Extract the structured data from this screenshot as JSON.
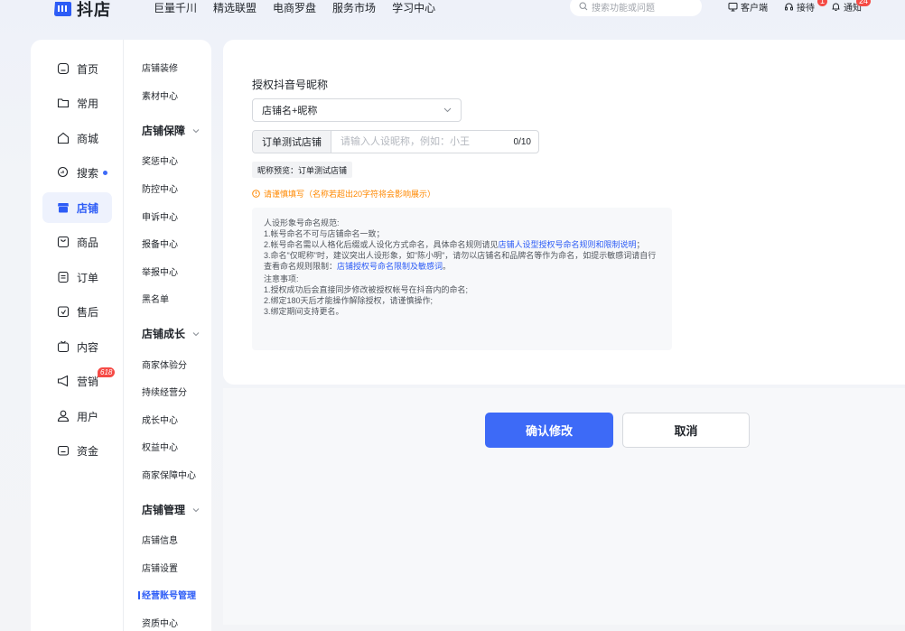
{
  "brand": {
    "name": "抖店",
    "color": "#2d5cf6"
  },
  "topnav": [
    "巨量千川",
    "精选联盟",
    "电商罗盘",
    "服务市场",
    "学习中心"
  ],
  "search": {
    "placeholder": "搜索功能或问题"
  },
  "topright": [
    {
      "icon": "monitor-icon",
      "label": "客户端",
      "badge": ""
    },
    {
      "icon": "headset-icon",
      "label": "接待",
      "badge": "1"
    },
    {
      "icon": "bell-icon",
      "label": "通知",
      "badge": "24"
    }
  ],
  "sidebar": {
    "items": [
      {
        "icon": "home-icon",
        "label": "首页"
      },
      {
        "icon": "folder-icon",
        "label": "常用"
      },
      {
        "icon": "mall-icon",
        "label": "商城"
      },
      {
        "icon": "search-icon",
        "label": "搜索"
      },
      {
        "icon": "store-icon",
        "label": "店铺"
      },
      {
        "icon": "product-icon",
        "label": "商品"
      },
      {
        "icon": "order-icon",
        "label": "订单"
      },
      {
        "icon": "aftersale-icon",
        "label": "售后"
      },
      {
        "icon": "content-icon",
        "label": "内容"
      },
      {
        "icon": "megaphone-icon",
        "label": "营销",
        "tag": "618"
      },
      {
        "icon": "user-icon",
        "label": "用户"
      },
      {
        "icon": "wallet-icon",
        "label": "资金"
      }
    ],
    "active_index": 4
  },
  "subnav": {
    "top": [
      "店铺装修",
      "素材中心"
    ],
    "groups": [
      {
        "title": "店铺保障",
        "items": [
          "奖惩中心",
          "防控中心",
          "申诉中心",
          "报备中心",
          "举报中心",
          "黑名单"
        ]
      },
      {
        "title": "店铺成长",
        "items": [
          "商家体验分",
          "持续经营分",
          "成长中心",
          "权益中心",
          "商家保障中心"
        ]
      },
      {
        "title": "店铺管理",
        "items": [
          "店铺信息",
          "店铺设置",
          "经营账号管理",
          "资质中心"
        ]
      }
    ],
    "active": "经营账号管理"
  },
  "form": {
    "label": "授权抖音号昵称",
    "select_value": "店铺名+昵称",
    "prefix": "订单测试店铺",
    "input_value": "",
    "input_placeholder": "请输入人设昵称，例如：小王",
    "counter": "0/10",
    "preview": "昵称预览：订单测试店铺",
    "warning": "请谨慎填写（名称若超出20字符将会影响展示）"
  },
  "rules": {
    "title": "人设形象号命名规范:",
    "r1": "1.帐号命名不可与店铺命名一致；",
    "r2_pre": "2.帐号命名需以人格化后缀或人设化方式命名，具体命名规则请见",
    "r2_link": "店铺人设型授权号命名规则和限制说明",
    "r2_post": "；",
    "r3_pre": "3.命名\"仅昵称\"时，建议突出人设形象，如\"陈小明\"，请勿以店铺名和品牌名等作为命名，如提示敏感词请自行查看命名规则限制：",
    "r3_link": "店铺授权号命名限制及敏感词",
    "r3_post": "。",
    "notes_title": "注意事项:",
    "n1": "1.授权成功后会直接同步修改被授权帐号在抖音内的命名;",
    "n2": "2.绑定180天后才能操作解除授权，请谨慎操作;",
    "n3": "3.绑定期间支持更名。"
  },
  "buttons": {
    "confirm": "确认修改",
    "cancel": "取消"
  },
  "colors": {
    "accent": "#3d6af7",
    "warning": "#ff8800",
    "badge": "#f54a45"
  }
}
